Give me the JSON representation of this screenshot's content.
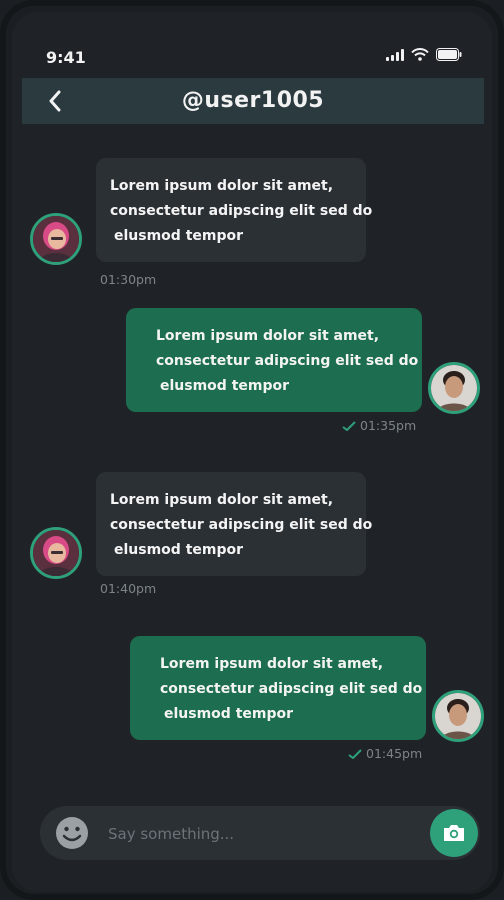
{
  "status_bar": {
    "time": "9:41"
  },
  "header": {
    "title": "@user1005"
  },
  "messages": [
    {
      "direction": "incoming",
      "lines": [
        "Lorem ipsum dolor sit amet,",
        "consectetur adipscing elit sed do",
        "elusmod tempor"
      ],
      "time": "01:30pm"
    },
    {
      "direction": "outgoing",
      "lines": [
        "Lorem ipsum dolor sit amet,",
        "consectetur adipscing elit sed do",
        "elusmod tempor"
      ],
      "time": "01:35pm"
    },
    {
      "direction": "incoming",
      "lines": [
        "Lorem ipsum dolor sit amet,",
        "consectetur adipscing elit sed do",
        "elusmod tempor"
      ],
      "time": "01:40pm"
    },
    {
      "direction": "outgoing",
      "lines": [
        "Lorem ipsum dolor sit amet,",
        "consectetur adipscing elit sed do",
        "elusmod tempor"
      ],
      "time": "01:45pm"
    }
  ],
  "composer": {
    "placeholder": "Say something..."
  },
  "icons": {
    "back": "chevron-left-icon",
    "emoji": "smiley-icon",
    "camera": "camera-icon",
    "read_receipt": "check-icon"
  },
  "colors": {
    "background": "#1f2327",
    "header": "#2b3a3f",
    "incoming_bubble": "#2b3035",
    "outgoing_bubble": "#1d6e51",
    "accent": "#2ea07a"
  }
}
